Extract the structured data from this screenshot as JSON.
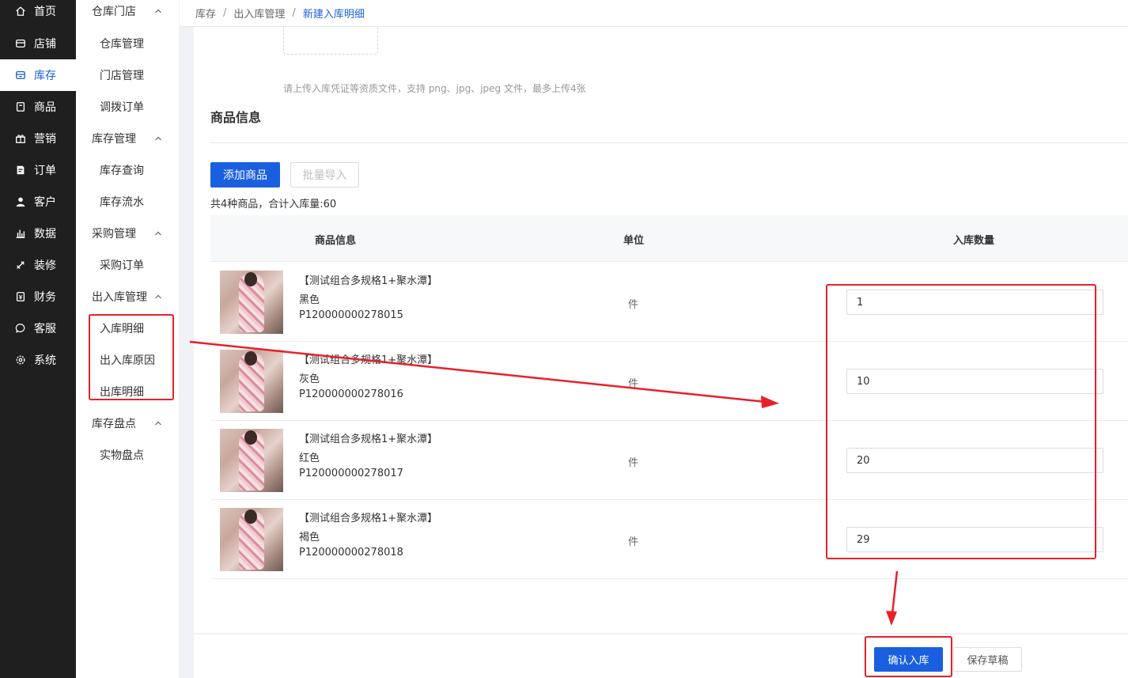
{
  "nav": {
    "items": [
      {
        "label": "首页",
        "icon": "home-icon"
      },
      {
        "label": "店铺",
        "icon": "shop-icon"
      },
      {
        "label": "库存",
        "icon": "inventory-icon"
      },
      {
        "label": "商品",
        "icon": "product-icon"
      },
      {
        "label": "营销",
        "icon": "gift-icon"
      },
      {
        "label": "订单",
        "icon": "order-icon"
      },
      {
        "label": "客户",
        "icon": "user-icon"
      },
      {
        "label": "数据",
        "icon": "chart-icon"
      },
      {
        "label": "装修",
        "icon": "decor-icon"
      },
      {
        "label": "财务",
        "icon": "finance-icon"
      },
      {
        "label": "客服",
        "icon": "chat-icon"
      },
      {
        "label": "系统",
        "icon": "gear-icon"
      }
    ],
    "active_color": "#1a5fe0"
  },
  "submenu": {
    "groups": [
      {
        "label": "仓库门店",
        "items": [
          "仓库管理",
          "门店管理",
          "调拨订单"
        ]
      },
      {
        "label": "库存管理",
        "items": [
          "库存查询",
          "库存流水"
        ]
      },
      {
        "label": "采购管理",
        "items": [
          "采购订单"
        ]
      },
      {
        "label": "出入库管理",
        "items": [
          "入库明细",
          "出入库原因",
          "出库明细"
        ]
      },
      {
        "label": "库存盘点",
        "items": [
          "实物盘点"
        ]
      }
    ]
  },
  "breadcrumb": {
    "items": [
      "库存",
      "出入库管理"
    ],
    "current": "新建入库明细",
    "separator": "/"
  },
  "upload": {
    "tip": "请上传入库凭证等资质文件，支持 png、jpg、jpeg 文件，最多上传4张"
  },
  "goods": {
    "title": "商品信息",
    "add_button": "添加商品",
    "import_button": "批量导入",
    "summary": "共4种商品，合计入库量:60",
    "columns": [
      "商品信息",
      "单位",
      "入库数量"
    ],
    "rows": [
      {
        "name": "【测试组合多规格1+聚水潭】",
        "spec": "黑色",
        "code": "P120000000278015",
        "unit": "件",
        "qty": "1"
      },
      {
        "name": "【测试组合多规格1+聚水潭】",
        "spec": "灰色",
        "code": "P120000000278016",
        "unit": "件",
        "qty": "10"
      },
      {
        "name": "【测试组合多规格1+聚水潭】",
        "spec": "红色",
        "code": "P120000000278017",
        "unit": "件",
        "qty": "20"
      },
      {
        "name": "【测试组合多规格1+聚水潭】",
        "spec": "褐色",
        "code": "P120000000278018",
        "unit": "件",
        "qty": "29"
      }
    ]
  },
  "footer": {
    "confirm_button": "确认入库",
    "draft_button": "保存草稿"
  },
  "colors": {
    "primary": "#1a5fe0",
    "annotation": "#e8202a",
    "sidebar_bg": "#1f1f1f"
  }
}
